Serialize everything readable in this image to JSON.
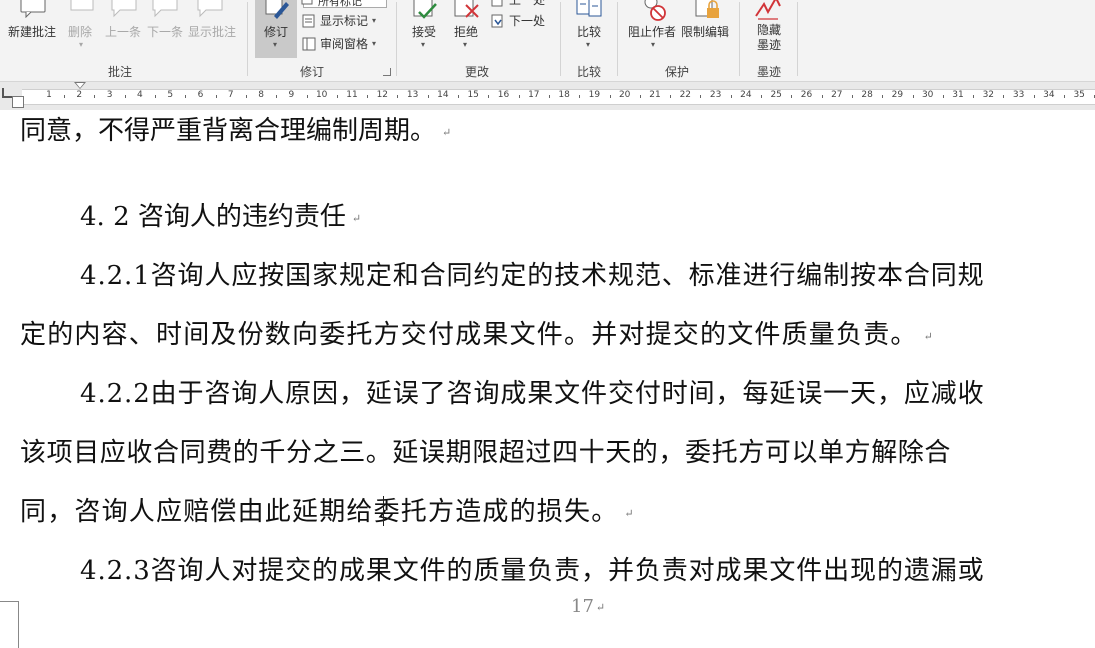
{
  "ribbon": {
    "comment_group": {
      "label": "批注",
      "new_comment": "新建批注",
      "delete": "删除",
      "previous": "上一条",
      "next": "下一条",
      "show_comments": "显示批注"
    },
    "track_group": {
      "label": "修订",
      "track_changes": "修订",
      "markup_dropdown": "所有标记",
      "show_markup": "显示标记",
      "reviewing_pane": "审阅窗格"
    },
    "changes_group": {
      "label": "更改",
      "accept": "接受",
      "reject": "拒绝",
      "previous": "上一处",
      "next": "下一处"
    },
    "compare_group": {
      "label": "比较",
      "compare": "比较"
    },
    "protect_group": {
      "label": "保护",
      "block_authors": "阻止作者",
      "restrict_editing": "限制编辑"
    },
    "ink_group": {
      "label": "墨迹",
      "hide_ink_line1": "隐藏",
      "hide_ink_line2": "墨迹"
    }
  },
  "ruler": {
    "numbers": [
      "1",
      "2",
      "3",
      "4",
      "5",
      "6",
      "7",
      "8",
      "9",
      "10",
      "11",
      "12",
      "13",
      "14",
      "15",
      "16",
      "17",
      "18",
      "19",
      "20",
      "21",
      "22",
      "23",
      "24",
      "25",
      "26",
      "27",
      "28",
      "29",
      "30",
      "31",
      "32",
      "33",
      "34",
      "35"
    ]
  },
  "document": {
    "line1": "同意，不得严重背离合理编制周期。",
    "heading": "4. 2 咨询人的违约责任",
    "p421_line1": "4.2.1咨询人应按国家规定和合同约定的技术规范、标准进行编制按本合同规",
    "p421_line2": "定的内容、时间及份数向委托方交付成果文件。并对提交的文件质量负责。",
    "p422_line1": "4.2.2由于咨询人原因，延误了咨询成果文件交付时间，每延误一天，应减收",
    "p422_line2": "该项目应收合同费的千分之三。延误期限超过四十天的，委托方可以单方解除合",
    "p422_line3": "同，咨询人应赔偿由此延期给委托方造成的损失。",
    "p423_line1": "4.2.3咨询人对提交的成果文件的质量负责，并负责对成果文件出现的遗漏或",
    "para_mark": "↵",
    "page_number": "17"
  },
  "colors": {
    "ribbon_bg": "#f3f3f3",
    "accent_blue": "#2b5797",
    "reject_red": "#d13438",
    "accept_green": "#2e8b3e"
  }
}
